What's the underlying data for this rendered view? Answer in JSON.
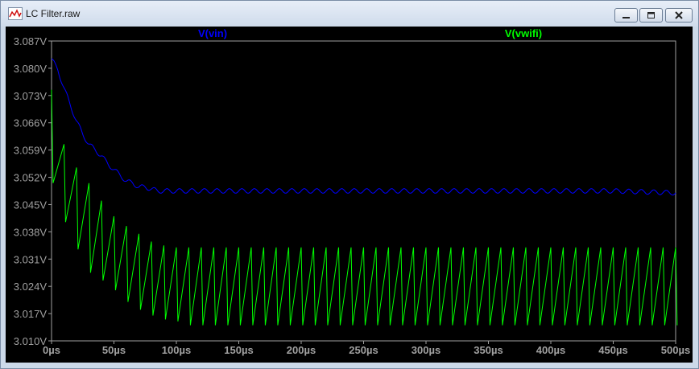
{
  "window": {
    "title": "LC Filter.raw",
    "minimize_icon": "minimize-icon",
    "maximize_icon": "maximize-icon",
    "close_icon": "close-icon",
    "app_icon": "waveform-icon"
  },
  "chart_data": {
    "type": "line",
    "background": "#000000",
    "x_tick_labels": [
      "0µs",
      "50µs",
      "100µs",
      "150µs",
      "200µs",
      "250µs",
      "300µs",
      "350µs",
      "400µs",
      "450µs",
      "500µs"
    ],
    "y_tick_labels": [
      "3.087V",
      "3.080V",
      "3.073V",
      "3.066V",
      "3.059V",
      "3.052V",
      "3.045V",
      "3.038V",
      "3.031V",
      "3.024V",
      "3.017V",
      "3.010V"
    ],
    "xlim": [
      0,
      500
    ],
    "ylim": [
      3.01,
      3.087
    ],
    "grid": false,
    "series": [
      {
        "name": "V(vin)",
        "color": "#0000ff",
        "x": [
          0,
          5,
          10,
          15,
          20,
          25,
          30,
          35,
          40,
          45,
          50,
          55,
          60,
          65,
          70,
          75,
          80,
          85,
          90,
          95,
          100,
          110,
          120,
          130,
          140,
          150,
          175,
          200,
          250,
          300,
          350,
          400,
          450,
          500
        ],
        "values": [
          3.0825,
          3.0795,
          3.075,
          3.0705,
          3.0665,
          3.063,
          3.0605,
          3.059,
          3.0575,
          3.0555,
          3.054,
          3.0525,
          3.051,
          3.0505,
          3.0495,
          3.0495,
          3.049,
          3.0485,
          3.0485,
          3.0485,
          3.0485,
          3.0485,
          3.0485,
          3.0485,
          3.0485,
          3.0485,
          3.0485,
          3.0485,
          3.0485,
          3.0485,
          3.0485,
          3.0485,
          3.0485,
          3.048
        ],
        "ripple_amplitude": 0.0006
      },
      {
        "name": "V(vwifi)",
        "color": "#00ff00",
        "ripple_period_us": 10,
        "peaks_x": [
          0,
          10,
          20,
          30,
          40,
          50,
          60,
          70,
          80,
          90,
          100,
          110,
          120,
          130,
          140,
          150,
          200,
          300,
          400,
          500
        ],
        "peaks_y": [
          3.0745,
          3.0605,
          3.0545,
          3.0505,
          3.046,
          3.042,
          3.0395,
          3.0375,
          3.0355,
          3.0345,
          3.034,
          3.034,
          3.034,
          3.034,
          3.034,
          3.034,
          3.034,
          3.034,
          3.034,
          3.034
        ],
        "troughs_x": [
          0,
          10,
          20,
          30,
          40,
          50,
          60,
          70,
          80,
          90,
          100,
          110,
          120,
          130,
          140,
          150,
          200,
          300,
          400,
          500
        ],
        "troughs_y": [
          3.0505,
          3.0405,
          3.0335,
          3.0275,
          3.0255,
          3.023,
          3.02,
          3.018,
          3.0165,
          3.0155,
          3.015,
          3.014,
          3.014,
          3.014,
          3.014,
          3.014,
          3.014,
          3.014,
          3.014,
          3.014
        ]
      }
    ]
  }
}
